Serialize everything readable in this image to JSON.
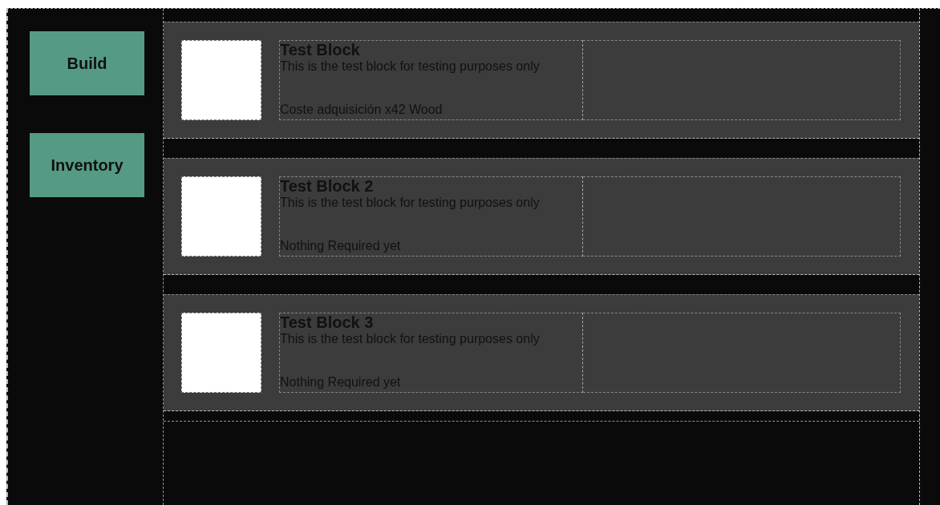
{
  "sidebar": {
    "buttons": [
      {
        "label": "Build"
      },
      {
        "label": "Inventory"
      }
    ]
  },
  "blocks": [
    {
      "title": "Test Block",
      "description": "This is the test block for testing purposes only",
      "requirement": "Coste adquisición x42 Wood"
    },
    {
      "title": "Test Block 2",
      "description": "This is the test block for testing purposes only",
      "requirement": "Nothing Required yet"
    },
    {
      "title": "Test Block 3",
      "description": "This is the test block for testing purposes only",
      "requirement": "Nothing Required yet"
    }
  ]
}
